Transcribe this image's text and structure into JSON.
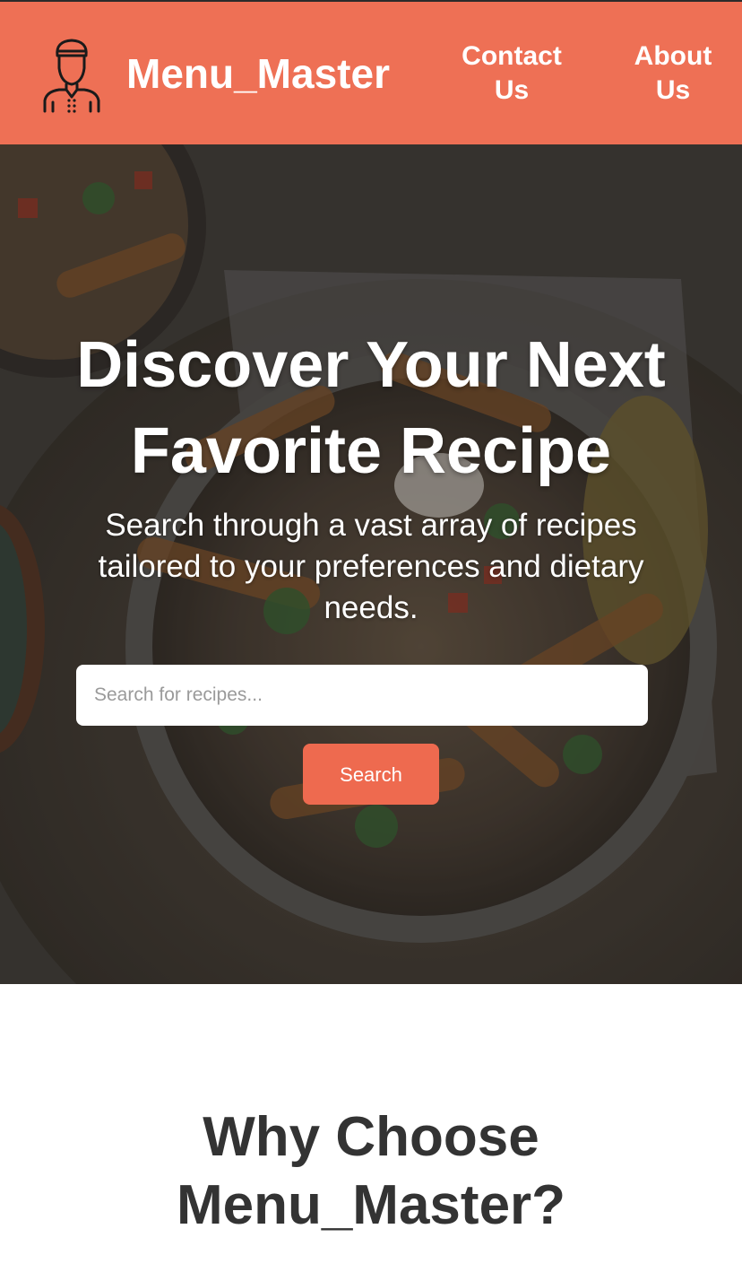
{
  "header": {
    "brand": "Menu_Master",
    "logo_icon": "chef-icon",
    "nav": [
      {
        "line1": "Contact",
        "line2": "Us"
      },
      {
        "line1": "About",
        "line2": "Us"
      }
    ]
  },
  "hero": {
    "title": "Discover Your Next Favorite Recipe",
    "subtitle": "Search through a vast array of recipes tailored to your preferences and dietary needs.",
    "search": {
      "placeholder": "Search for recipes...",
      "value": "",
      "button_label": "Search"
    }
  },
  "why": {
    "title": "Why Choose Menu_Master?"
  },
  "colors": {
    "accent": "#ee7055",
    "button": "#ee6a4f",
    "heading": "#333333"
  }
}
